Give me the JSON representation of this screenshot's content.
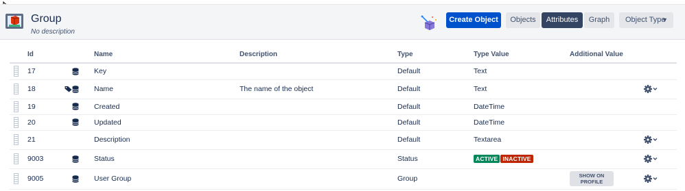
{
  "header": {
    "title": "Group",
    "subtitle": "No description"
  },
  "toolbar": {
    "create_label": "Create Object",
    "objects_label": "Objects",
    "attributes_label": "Attributes",
    "graph_label": "Graph",
    "object_type_label": "Object Type"
  },
  "table": {
    "headers": {
      "id": "Id",
      "name": "Name",
      "description": "Description",
      "type": "Type",
      "type_value": "Type Value",
      "additional_value": "Additional Value"
    },
    "rows": [
      {
        "id": "17",
        "name": "Key",
        "description": "",
        "type": "Default",
        "type_value": "Text",
        "icons": [
          "database-icon"
        ],
        "gear": false
      },
      {
        "id": "18",
        "name": "Name",
        "description": "The name of the object",
        "type": "Default",
        "type_value": "Text",
        "icons": [
          "tag-icon",
          "database-icon"
        ],
        "gear": true
      },
      {
        "id": "19",
        "name": "Created",
        "description": "",
        "type": "Default",
        "type_value": "DateTime",
        "icons": [
          "database-icon"
        ],
        "gear": false
      },
      {
        "id": "20",
        "name": "Updated",
        "description": "",
        "type": "Default",
        "type_value": "DateTime",
        "icons": [
          "database-icon"
        ],
        "gear": false
      },
      {
        "id": "21",
        "name": "Description",
        "description": "",
        "type": "Default",
        "type_value": "Textarea",
        "icons": [],
        "gear": true
      },
      {
        "id": "9003",
        "name": "Status",
        "description": "",
        "type": "Status",
        "type_value": "",
        "icons": [
          "database-icon"
        ],
        "gear": true
      },
      {
        "id": "9005",
        "name": "User Group",
        "description": "",
        "type": "Group",
        "type_value": "",
        "icons": [
          "database-icon"
        ],
        "gear": true
      }
    ],
    "status_values": [
      "ACTIVE",
      "INACTIVE"
    ],
    "show_on_profile_lines": [
      "SHOW ON",
      "PROFILE"
    ]
  },
  "colors": {
    "primary": "#0052cc",
    "active_tab": "#344563",
    "status_active": "#00875a",
    "status_inactive": "#bf2600"
  }
}
